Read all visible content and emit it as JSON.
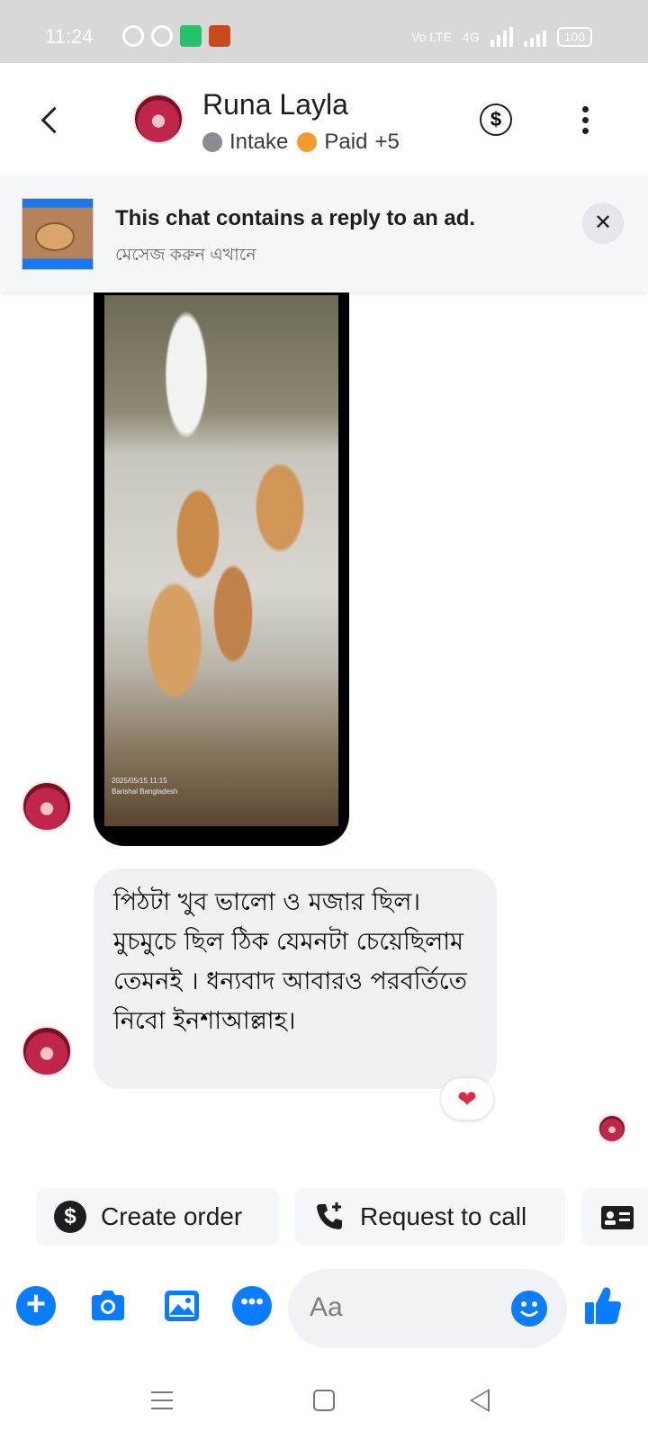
{
  "status_bar": {
    "time": "11:24",
    "network_label": "Vo LTE",
    "network_type": "4G",
    "battery": "100"
  },
  "header": {
    "contact_name": "Runa Layla",
    "tag_intake": "Intake",
    "tag_paid": "Paid",
    "tag_more": "+5",
    "tag_intake_color": "#8a8d91",
    "tag_paid_color": "#f39a2e"
  },
  "ad_banner": {
    "title": "This chat contains a reply to an ad.",
    "subtitle": "মেসেজ করুন এখানে",
    "close_label": "✕"
  },
  "messages": {
    "media_stamp_line1": "2025/05/15 11:15",
    "media_stamp_line2": "Barishal Bangladesh",
    "text_message": "পিঠটা খুব ভালো ও মজার ছিল। মুচমুচে ছিল ঠিক যেমনটা চেয়েছিলাম তেমনই । ধন্যবাদ আবারও পরবর্তিতে নিবো ইনশাআল্লাহ।",
    "reaction": "❤"
  },
  "quick_actions": {
    "create_order": "Create order",
    "request_call": "Request to call"
  },
  "composer": {
    "placeholder": "Aa",
    "accent": "#0a7cff"
  }
}
